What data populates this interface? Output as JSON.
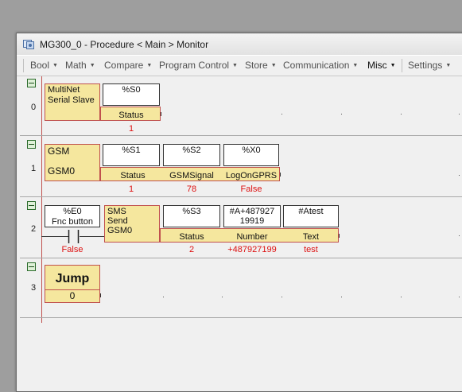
{
  "window": {
    "title": "MG300_0 - Procedure < Main > Monitor"
  },
  "menu": {
    "items": [
      {
        "label": "Bool",
        "caret": "▼"
      },
      {
        "label": "Math",
        "caret": "▼"
      },
      {
        "label": "Compare",
        "caret": "▼"
      },
      {
        "label": "Program Control",
        "caret": "▼"
      },
      {
        "label": "Store",
        "caret": "▼"
      },
      {
        "label": "Communication",
        "caret": "▼"
      },
      {
        "label": "Misc",
        "caret": "▼"
      },
      {
        "label": "Settings",
        "caret": "▼"
      }
    ]
  },
  "colors": {
    "rail": "#c0504d",
    "block_fill": "#f5e79e",
    "value_text": "#d11111"
  },
  "rungs": [
    {
      "number": "0",
      "block": {
        "line1": "MultiNet",
        "line2": "Serial Slave"
      },
      "params": [
        {
          "var": "%S0",
          "label": "Status",
          "value": "1"
        }
      ]
    },
    {
      "number": "1",
      "block": {
        "line1": "GSM",
        "line2": "GSM0"
      },
      "params": [
        {
          "var": "%S1",
          "label": "Status",
          "value": "1"
        },
        {
          "var": "%S2",
          "label": "GSMSignal",
          "value": "78"
        },
        {
          "var": "%X0",
          "label": "LogOnGPRS",
          "value": "False"
        }
      ]
    },
    {
      "number": "2",
      "contact": {
        "var": "%E0",
        "desc": "Fnc button",
        "value": "False"
      },
      "block": {
        "line1": "SMS",
        "line2": "Send",
        "line3": "GSM0"
      },
      "params": [
        {
          "var": "%S3",
          "var2": "",
          "label": "Status",
          "value": "2"
        },
        {
          "var": "#A+487927",
          "var2": "19919",
          "label": "Number",
          "value": "+487927199"
        },
        {
          "var": "#Atest",
          "var2": "",
          "label": "Text",
          "value": "test"
        }
      ]
    },
    {
      "number": "3",
      "block": {
        "line1": "Jump"
      },
      "value": "0"
    }
  ]
}
